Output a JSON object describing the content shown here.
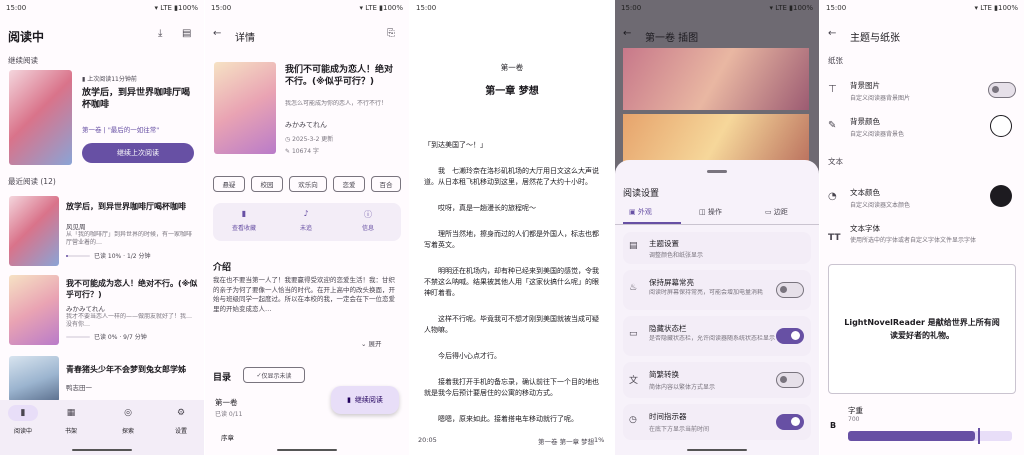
{
  "status": {
    "time": "15:00",
    "net": "LTE",
    "battery": "100%"
  },
  "p1": {
    "title": "阅读中",
    "continue_header": "继续阅读",
    "last_read": "上次阅读11分钟前",
    "book_title": "放学后，到异世界咖啡厅喝杯咖啡",
    "chapter": "第一卷 | \"最后的一如往常\"",
    "continue_btn": "继续上次阅读",
    "recent_header": "最近阅读 (12)",
    "items": [
      {
        "title": "放学后，到异世界咖啡厅喝杯咖啡",
        "author": "风见周",
        "desc": "从「我的咖啡厅」到异世界的时候，有一家咖啡厅营业着的…",
        "meta": "已读 10% · 1/2 分钟"
      },
      {
        "title": "我不可能成为恋人！绝对不行。(※似乎可行？)",
        "author": "みかみてれん",
        "desc": "我才不要当恋人一样的——做朋友就好了！我…没有你…",
        "meta": "已读 0% · 9/7 分钟"
      },
      {
        "title": "青春猪头少年不会梦到兔女郎学姊",
        "author": "鸭志田一",
        "desc": "",
        "meta": ""
      }
    ],
    "nav": [
      "阅读中",
      "书架",
      "探索",
      "设置"
    ]
  },
  "p2": {
    "header": "详情",
    "book_title": "我们不可能成为恋人！绝对不行。(※似乎可行？)",
    "alt_title": "我怎么可能成为你的恋人，不行不行！",
    "author": "みかみてれん",
    "date": "2025-3-2 更新",
    "words": "10674 字",
    "tags": [
      "悬疑",
      "校园",
      "欢乐向",
      "恋爱",
      "百合"
    ],
    "actions": [
      "查看收藏",
      "未追",
      "信息"
    ],
    "intro_header": "介绍",
    "intro": "我在也不要当第一人了！我要赢得受欢迎的恋爱生活！我：甘织的亲子为何了要像一人恰当的时代。在开上高中的改头换面，开始与班级同学一起度过。所以在本校的我，一定会在下一位恋爱里的开始变成恋人…",
    "expand": "展开",
    "toc_header": "目录",
    "toc_btn": "仅显示未读",
    "vol": "第一卷",
    "vol_sub": "已读 0/11",
    "chapter": "序章",
    "fab": "继续阅读"
  },
  "p3": {
    "vol": "第一卷",
    "chapter": "第一章 梦想",
    "paragraphs": [
      "「到达美国了～！」",
      "我　七濑玲奈在洛杉矶机场的大厅用日文这么大声说道。从日本租飞机移动到这里，居然花了大约十小时。",
      "哎呀，真是一趟漫长的旅程呢～",
      "理所当然地，擦身而过的人们都是外国人，标志也都写着英文。",
      "明明还在机场内，却有种已经来到美国的感觉，令我不禁这么呐喊。结果被其他人用「这家伙搞什么呢」的眼神盯着看。",
      "这样不行呢。毕竟我可不想才刚到美国就被当成可疑人物嘛。",
      "今后得小心点才行。",
      "接着我打开手机的备忘录，确认前往下一个目的地也就是我今后预计要居住的公寓的移动方式。",
      "嗯嗯，原来如此。接着搭电车移动就行了呢。"
    ],
    "time": "20:05",
    "loc": "第一卷 第一章 梦想",
    "pct": "1%"
  },
  "p4": {
    "header": "第一卷 插图",
    "sheet_title": "阅读设置",
    "tabs": [
      "外观",
      "操作",
      "边距"
    ],
    "rows": [
      {
        "title": "主题设置",
        "sub": "调整颜色和纸张显示"
      },
      {
        "title": "保持屏幕常亮",
        "sub": "阅读时屏幕保持常亮，可能会增加电量消耗",
        "toggle": false
      },
      {
        "title": "隐藏状态栏",
        "sub": "是否隐藏状态栏，允许阅读器随系统状态栏显示",
        "toggle": true
      },
      {
        "title": "简繁转换",
        "sub": "简体内容以繁体方式显示",
        "toggle": false
      },
      {
        "title": "时间指示器",
        "sub": "在底下方显示当前时间",
        "toggle": true
      }
    ]
  },
  "p5": {
    "header": "主题与纸张",
    "paper_header": "纸张",
    "bg_title": "背景图片",
    "bg_sub": "自定义阅读器背景图片",
    "bgc_title": "背景颜色",
    "bgc_sub": "自定义阅读器背景色",
    "text_header": "文本",
    "tc_title": "文本颜色",
    "tc_sub": "自定义阅读器文本颜色",
    "tf_title": "文本字体",
    "tf_sub": "使用所选中的字体或者自定义字体文件显示字体",
    "preview": "LightNovelReader 是献给世界上所有阅读爱好者的礼物。",
    "size_title": "字重",
    "size_val": "700",
    "size_pct": 0.8,
    "size_letter": "B",
    "accent": "#6750a4"
  }
}
